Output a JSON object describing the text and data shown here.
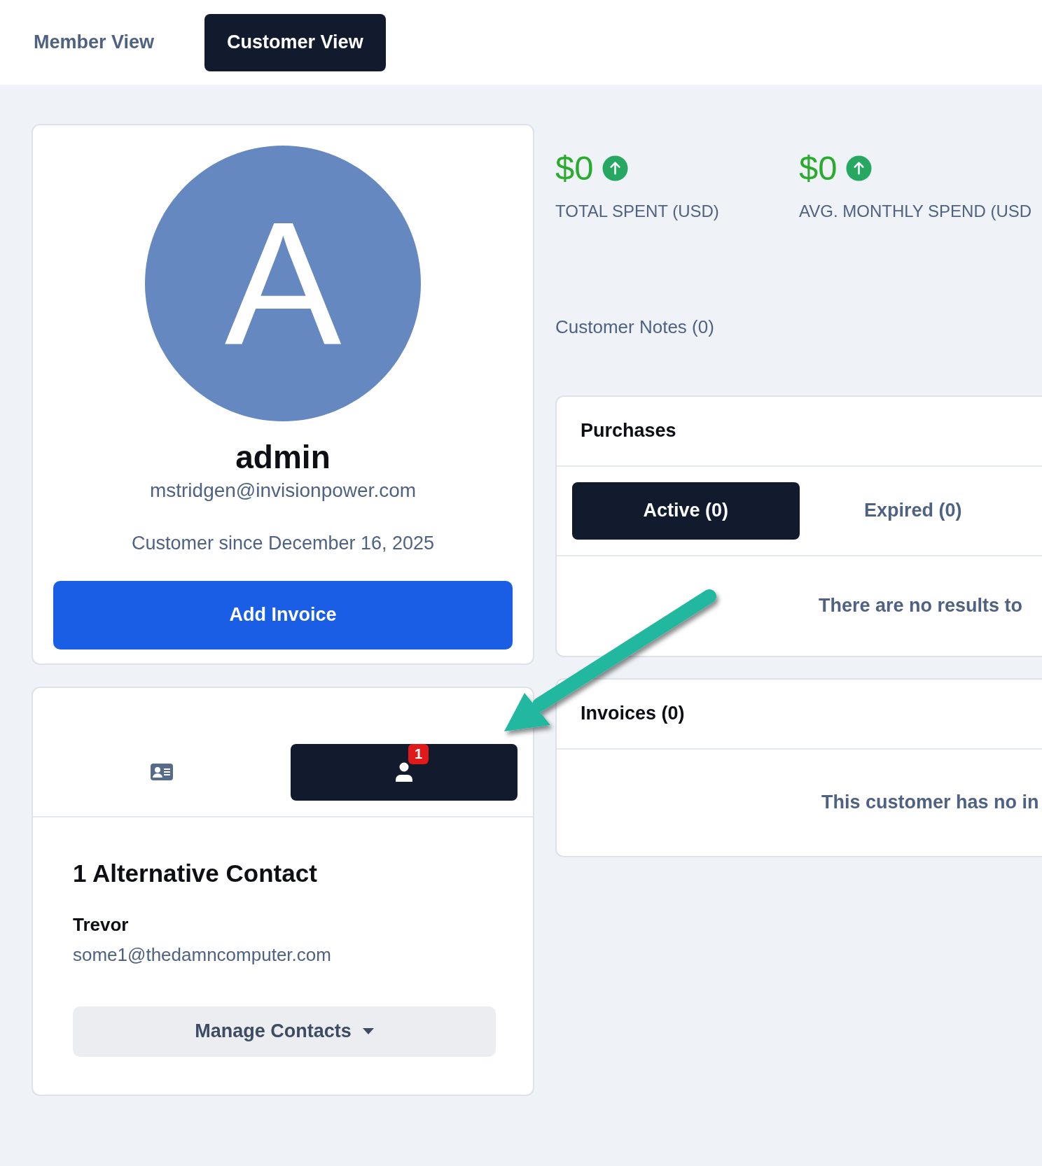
{
  "view_tabs": [
    {
      "label": "Member View",
      "selected": false
    },
    {
      "label": "Customer View",
      "selected": true
    }
  ],
  "profile": {
    "avatar_letter": "A",
    "name": "admin",
    "email": "mstridgen@invisionpower.com",
    "since": "Customer since December 16, 2025",
    "add_button": "Add Invoice"
  },
  "contact_tabs": [
    {
      "kind": "id-card",
      "selected": false
    },
    {
      "kind": "person",
      "selected": true,
      "badge": "1"
    }
  ],
  "contacts": {
    "title": "1 Alternative Contact",
    "items": [
      {
        "name": "Trevor",
        "email": "some1@thedamncomputer.com"
      }
    ],
    "manage_button": "Manage Contacts"
  },
  "stats": [
    {
      "value": "$0",
      "label": "TOTAL SPENT (USD)"
    },
    {
      "value": "$0",
      "label": "AVG. MONTHLY SPEND (USD"
    }
  ],
  "notes": "Customer Notes (0)",
  "purchases": {
    "title": "Purchases",
    "tabs": [
      {
        "label": "Active (0)",
        "selected": true
      },
      {
        "label": "Expired (0)",
        "selected": false
      }
    ],
    "empty": "There are no results to"
  },
  "invoices": {
    "title": "Invoices (0)",
    "empty": "This customer has no in"
  }
}
